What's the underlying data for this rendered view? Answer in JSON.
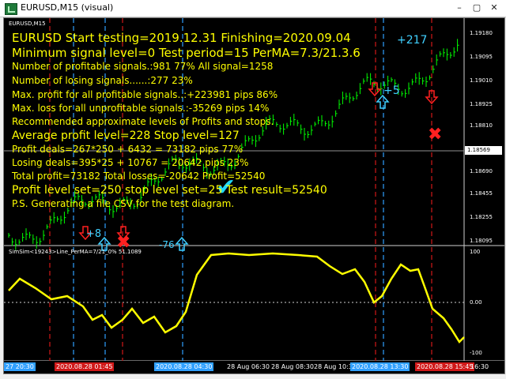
{
  "window": {
    "title": "EURUSD,M15 (visual)",
    "controls": {
      "minimize": "–",
      "maximize": "▢",
      "close": "✕"
    }
  },
  "chart": {
    "symbol_label": "EURUSD,M15",
    "indicator_label": "SimSim<19243>Line_PerMA=7/21_0% 51.1089",
    "current_price": "1.18569",
    "price_ticks": [
      "1.19180",
      "1.19095",
      "1.19010",
      "1.18925",
      "1.18810",
      "1.18690",
      "1.18455",
      "1.18340",
      "1.18255",
      "1.18120",
      "1.18095"
    ],
    "indicator_ticks": [
      "100",
      "0.00",
      "-100"
    ],
    "time_labels": [
      "27 20:30",
      "2020.08.28 01:45",
      "2020.08.28 04:30",
      "28 Aug 06:30",
      "28 Aug 08:30",
      "28 Aug 10:3",
      "2020.08.28 13:30",
      "2020.08.28 15:45",
      "16:30"
    ]
  },
  "report": {
    "line1": "EURUSD   Start testing=2019.12.31 Finishing=2020.09.04",
    "line2": "Minimum signal level=0  Test period=15 PerMA=7.3/21.3.6",
    "line3": "Number of profitable signals.:981  77%  All signal=1258",
    "line4": "Number of losing signals......:277  23%",
    "line5": "Max. profit for all profitable signals..:+223981 pips  86%",
    "line6": "Max. loss for all unprofitable signals.:-35269 pips  14%",
    "line7": "Recommended approximate levels of Profits and stops.",
    "line8": "Average profit level=228 Stop level=127",
    "line9": "Profit   deals=267*250 + 6432 = 73182 pips 77%",
    "line10": "Losing deals=395*25 + 10767 = 20642 pips 23%",
    "line11": "Total profit=73182 Total losses=-20642 Profit=52540",
    "line12": "Profit level set=250 stop level set=25 Test result=52540",
    "line13": "P.S. Generating a file CSV for the test diagram."
  },
  "signals": {
    "up1": "+217",
    "up2": "+5",
    "up3": "+8",
    "up4": "-76"
  },
  "colors": {
    "background": "#000000",
    "report_text": "#ffff00",
    "indicator_line": "#ffff00",
    "bull_bar": "#00ff00",
    "grid": "#5a6b7a",
    "signal_up": "#40d0ff",
    "signal_down": "#ff2020"
  }
}
